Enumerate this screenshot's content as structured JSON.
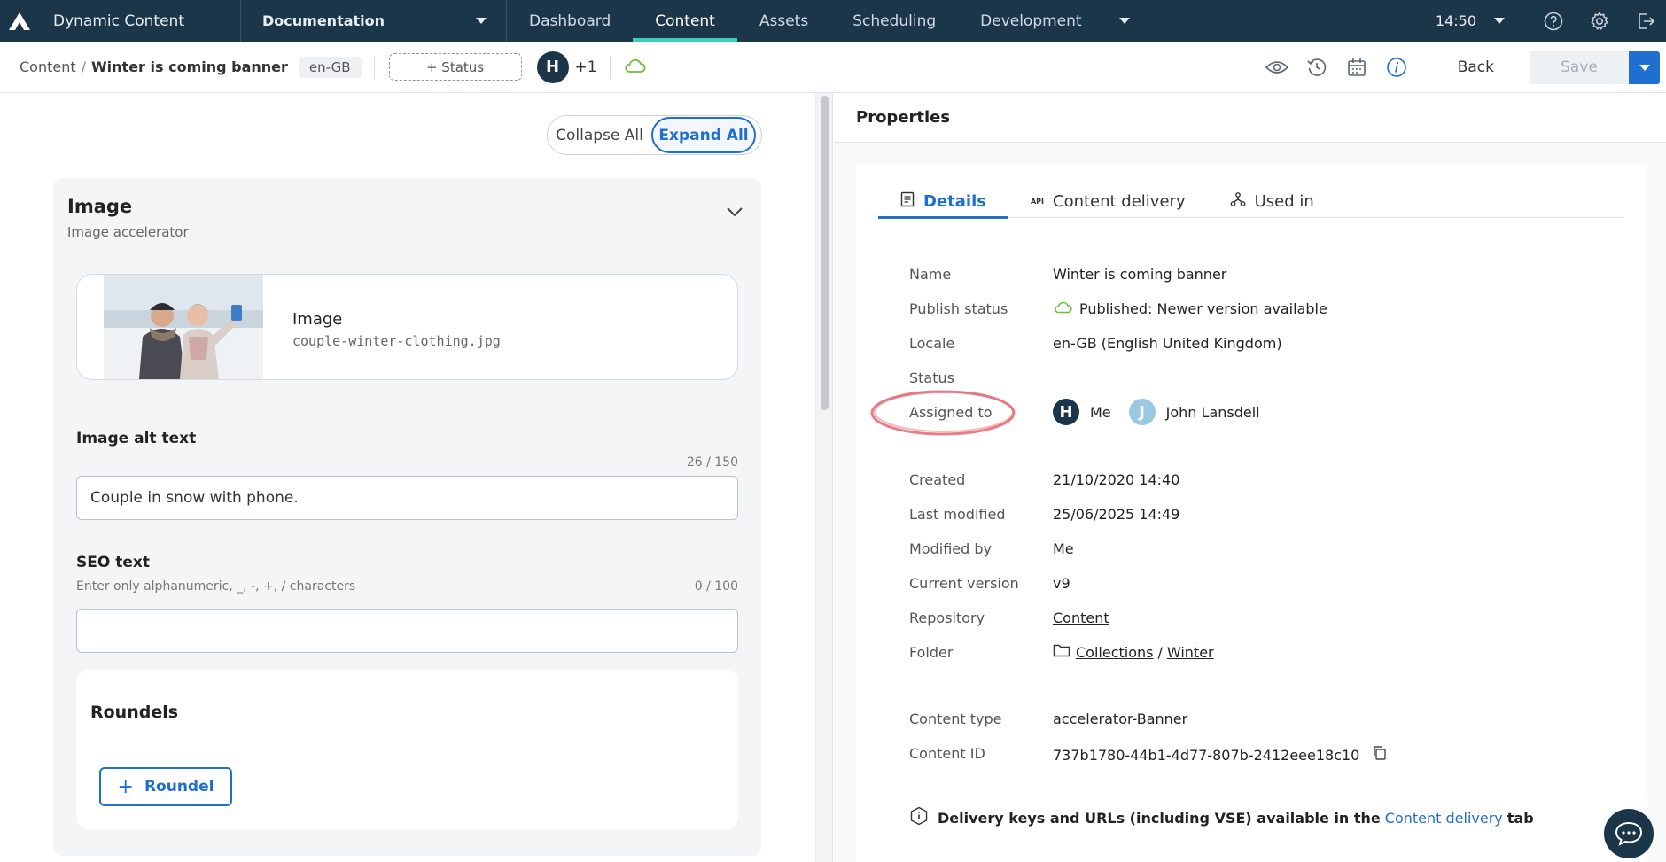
{
  "app": {
    "name": "Dynamic Content",
    "hub": "Documentation",
    "nav_tabs": [
      {
        "label": "Dashboard"
      },
      {
        "label": "Content"
      },
      {
        "label": "Assets"
      },
      {
        "label": "Scheduling"
      },
      {
        "label": "Development"
      }
    ],
    "time": "14:50"
  },
  "toolbar": {
    "breadcrumb_root": "Content",
    "breadcrumb_sep": "/",
    "breadcrumb_current": "Winter is coming banner",
    "locale": "en-GB",
    "status_button": "+ Status",
    "avatar_initial": "H",
    "extra_assignees": "+1",
    "back_label": "Back",
    "save_label": "Save"
  },
  "editor": {
    "collapse_all": "Collapse All",
    "expand_all": "Expand All",
    "card_title": "Image",
    "card_subtitle": "Image accelerator",
    "image_label": "Image",
    "image_filename": "couple-winter-clothing.jpg",
    "alt_label": "Image alt text",
    "alt_counter": "26 / 150",
    "alt_value": "Couple in snow with phone.",
    "seo_label": "SEO text",
    "seo_hint": "Enter only alphanumeric, _, -, +, / characters",
    "seo_counter": "0 / 100",
    "seo_value": "",
    "roundels_title": "Roundels",
    "roundel_button": "Roundel"
  },
  "properties": {
    "title": "Properties",
    "tabs": [
      {
        "label": "Details"
      },
      {
        "label": "Content delivery"
      },
      {
        "label": "Used in"
      }
    ],
    "api_icon_text": "API",
    "rows": {
      "name_label": "Name",
      "name_value": "Winter is coming banner",
      "publish_label": "Publish status",
      "publish_value": "Published: Newer version available",
      "locale_label": "Locale",
      "locale_value": "en-GB (English United Kingdom)",
      "status_label": "Status",
      "assigned_label": "Assigned to",
      "assignee_1_initial": "H",
      "assignee_1_name": "Me",
      "assignee_2_initial": "J",
      "assignee_2_name": "John Lansdell",
      "created_label": "Created",
      "created_value": "21/10/2020 14:40",
      "modified_label": "Last modified",
      "modified_value": "25/06/2025 14:49",
      "modified_by_label": "Modified by",
      "modified_by_value": "Me",
      "version_label": "Current version",
      "version_value": "v9",
      "repo_label": "Repository",
      "repo_value": "Content",
      "folder_label": "Folder",
      "folder_1": "Collections",
      "folder_sep": "/",
      "folder_2": "Winter",
      "type_label": "Content type",
      "type_value": "accelerator-Banner",
      "id_label": "Content ID",
      "id_value": "737b1780-44b1-4d77-807b-2412eee18c10"
    },
    "notice_text": "Delivery keys and URLs (including VSE) available in the",
    "notice_link": "Content delivery",
    "notice_tail": "tab"
  },
  "colors": {
    "nav_bg": "#1b3549",
    "accent": "#1f6fd0",
    "active_tab_underline": "#3ad0b8",
    "published_green": "#6cbf3c",
    "annotation_red": "#e05060"
  },
  "icons": [
    "amplience-logo-icon",
    "chevron-down-icon",
    "help-icon",
    "gear-icon",
    "logout-icon",
    "cloud-icon",
    "eye-icon",
    "history-icon",
    "calendar-icon",
    "info-icon",
    "details-icon",
    "api-icon",
    "hierarchy-icon",
    "folder-icon",
    "copy-icon",
    "chat-icon"
  ]
}
